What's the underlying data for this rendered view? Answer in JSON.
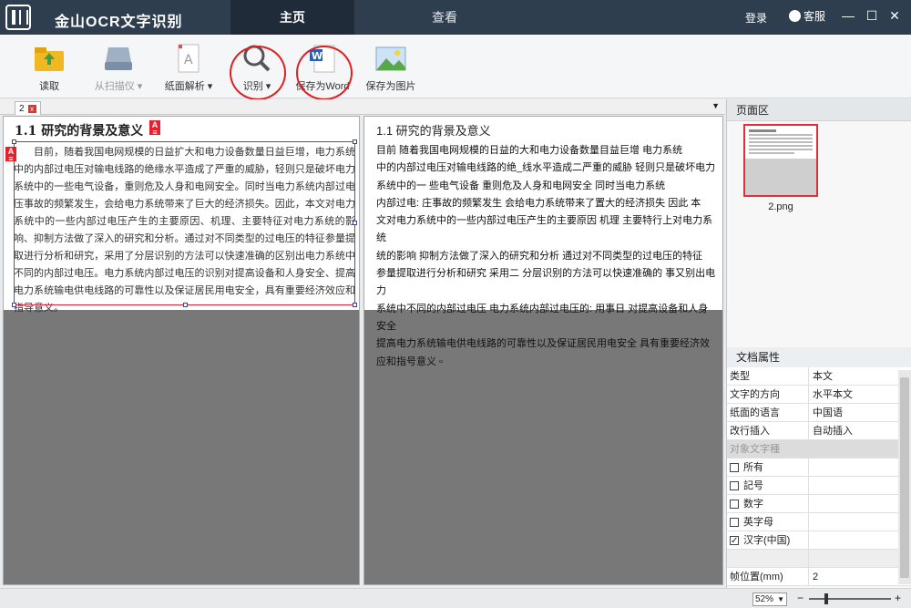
{
  "window": {
    "app_title": "金山OCR文字识别",
    "nav_tabs": [
      "主页",
      "查看"
    ],
    "login": "登录",
    "service": "客服"
  },
  "toolbar": {
    "buttons": [
      {
        "label": "读取",
        "icon": "folder-icon",
        "enabled": true
      },
      {
        "label": "从扫描仪",
        "icon": "scanner-icon",
        "enabled": false
      },
      {
        "label": "纸面解析",
        "icon": "page-analysis-icon",
        "enabled": true
      },
      {
        "label": "识别",
        "icon": "magnifier-icon",
        "enabled": true
      },
      {
        "label": "保存为Word",
        "icon": "word-doc-icon",
        "enabled": true
      },
      {
        "label": "保存为图片",
        "icon": "picture-icon",
        "enabled": true
      }
    ]
  },
  "document_tab": {
    "label": "2",
    "close": "x"
  },
  "left_panel": {
    "heading": "1.1  研究的背景及意义",
    "paragraph": "目前，随着我国电网规模的日益扩大和电力设备数量日益巨增，电力系统中的内部过电压对输电线路的绝缘水平造成了严重的威胁，轻则只是破坏电力系统中的一些电气设备，重则危及人身和电网安全。同时当电力系统内部过电压事故的频繁发生，会给电力系统带来了巨大的经济损失。因此，本文对电力系统中的一些内部过电压产生的主要原因、机理、主要特征对电力系统的影响、抑制方法做了深入的研究和分析。通过对不同类型的过电压的特征参量提取进行分析和研究，采用了分层识别的方法可以快速准确的区别出电力系统中不同的内部过电压。电力系统内部过电压的识别对提高设备和人身安全、提高电力系统输电供电线路的可靠性以及保证居民用电安全，具有重要经济效应和指导意义。",
    "badge": "A"
  },
  "right_panel": {
    "heading": "1.1    研究的背景及意义",
    "lines": [
      "    目前  随着我国电网规模的日益的大和电力设备数量目益巨增   电力系统",
      "中的内部过电压对输电线路的绝_线水平造成二严重的威胁  轻则只是破坏电力",
      "系统中的一 些电气设备  重则危及人身和电网安全  同时当电力系统",
      "内部过电: 庄事故的频繁发生  会给电力系统带来了置大的经济损失  因此  本",
      "文对电力系统中的一些内部过电压产生的主要原因    机理  主要特行上对电力系统",
      "统的影响  抑制方法做了深入的研究和分析  通过对不同类型的过电压的特征",
      "参量提取进行分析和研究    采用二  分层识别的方法可以快速准确的  事又别出电力",
      "系统中不同的内部过电压    电力系统内部过电压的: 用事日  对提高设备和人身安全",
      "提高电力系统输电供电线路的可靠性以及保证居民用电安全     具有重要经济效",
      "应和指号意义  ▫"
    ]
  },
  "sidebar": {
    "page_area_title": "页面区",
    "thumbnail_label": "2.png",
    "props_title": "文档属性",
    "props": [
      {
        "key": "类型",
        "value": "本文"
      },
      {
        "key": "文字的方向",
        "value": "水平本文"
      },
      {
        "key": "纸面的语言",
        "value": "中国语"
      },
      {
        "key": "改行插入",
        "value": "自动插入"
      }
    ],
    "group_label": "对象文字種",
    "checkboxes": [
      {
        "label": "所有",
        "checked": false
      },
      {
        "label": "記号",
        "checked": false
      },
      {
        "label": "数字",
        "checked": false
      },
      {
        "label": "英字母",
        "checked": false
      },
      {
        "label": "汉字(中国)",
        "checked": true
      }
    ],
    "position_row": {
      "key": "帧位置(mm)",
      "value": "2"
    }
  },
  "statusbar": {
    "zoom": "52%",
    "zoom_level": 0.2
  },
  "colors": {
    "titlebar": "#2f3e4f",
    "accent_red": "#e02020",
    "panel_gray": "#787878"
  }
}
